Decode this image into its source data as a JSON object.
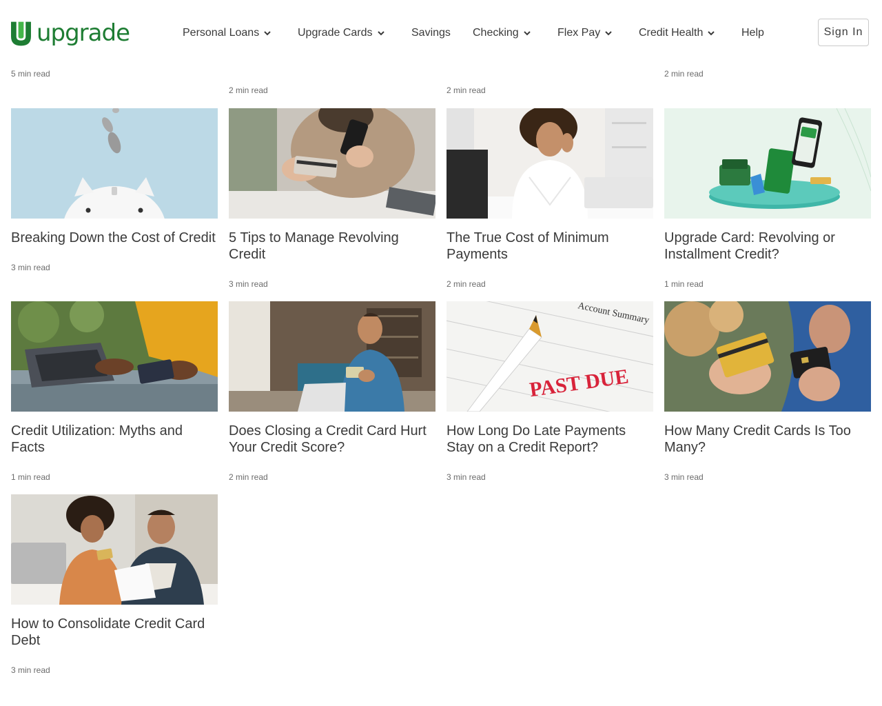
{
  "brand": {
    "name": "upgrade",
    "color": "#1e7d33",
    "icon": "upgrade-u-logo-icon"
  },
  "nav": {
    "items": [
      {
        "label": "Personal Loans",
        "dropdown": true
      },
      {
        "label": "Upgrade Cards",
        "dropdown": true
      },
      {
        "label": "Savings",
        "dropdown": false
      },
      {
        "label": "Checking",
        "dropdown": true
      },
      {
        "label": "Flex Pay",
        "dropdown": true
      },
      {
        "label": "Credit Health",
        "dropdown": true
      },
      {
        "label": "Help",
        "dropdown": false
      }
    ],
    "sign_in": "Sign In"
  },
  "previous_row_read_times": [
    "5 min read",
    "2 min read",
    "2 min read",
    "2 min read"
  ],
  "articles": [
    {
      "title": "Breaking Down the Cost of Credit",
      "read_time": "3 min read",
      "image": "piggy-bank-coins-image"
    },
    {
      "title": "5 Tips to Manage Revolving Credit",
      "read_time": "3 min read",
      "image": "woman-holding-card-and-phone-image"
    },
    {
      "title": "The True Cost of Minimum Payments",
      "read_time": "2 min read",
      "image": "stressed-woman-at-desk-image"
    },
    {
      "title": "Upgrade Card: Revolving or Installment Credit?",
      "read_time": "1 min read",
      "image": "upgrade-card-illustration-image"
    },
    {
      "title": "Credit Utilization: Myths and Facts",
      "read_time": "1 min read",
      "image": "woman-laptop-credit-card-image"
    },
    {
      "title": "Does Closing a Credit Card Hurt Your Credit Score?",
      "read_time": "2 min read",
      "image": "man-laptop-credit-card-image"
    },
    {
      "title": "How Long Do Late Payments Stay on a Credit Report?",
      "read_time": "3 min read",
      "image": "past-due-statement-image"
    },
    {
      "title": "How Many Credit Cards Is Too Many?",
      "read_time": "3 min read",
      "image": "hands-holding-credit-cards-image"
    },
    {
      "title": "How to Consolidate Credit Card Debt",
      "read_time": "3 min read",
      "image": "couple-reviewing-bills-image"
    }
  ],
  "past_due_stamp": "PAST DUE",
  "statement_heading": "Account Summary",
  "colors": {
    "text": "#3a3a3a",
    "muted": "#6b6b6b",
    "brand": "#1e7d33"
  }
}
